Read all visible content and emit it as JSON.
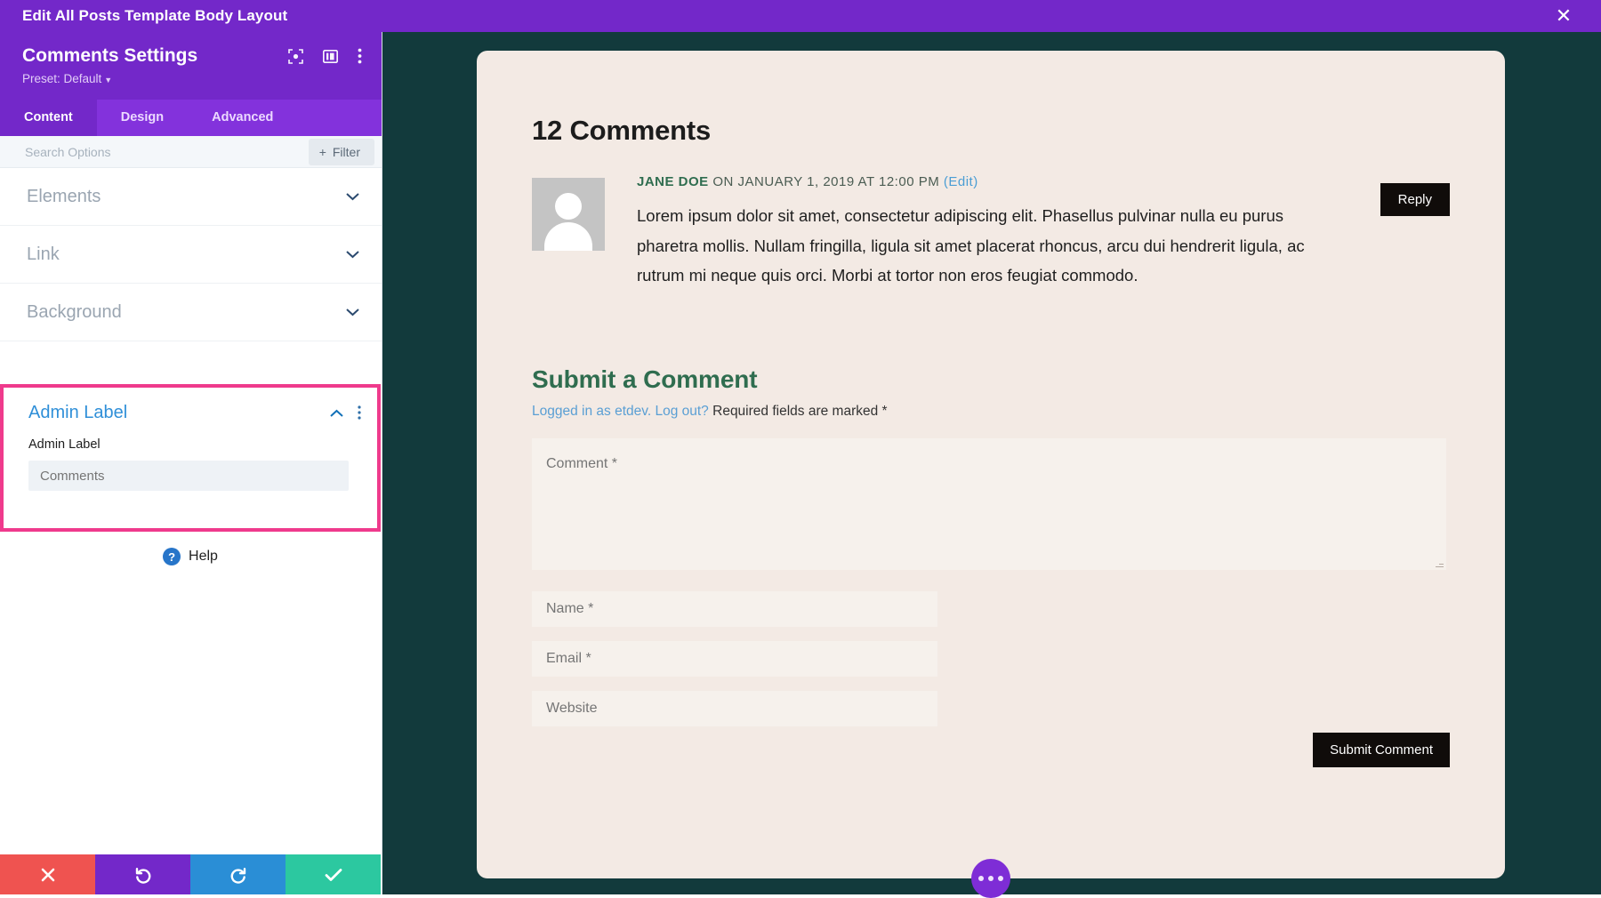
{
  "topbar": {
    "title": "Edit All Posts Template Body Layout",
    "close_icon": "close-icon"
  },
  "panel": {
    "title": "Comments Settings",
    "preset_label": "Preset: Default",
    "head_icons": [
      "fullscreen-icon",
      "layout-view-icon",
      "more-options-icon"
    ],
    "tabs": [
      {
        "label": "Content",
        "active": true
      },
      {
        "label": "Design",
        "active": false
      },
      {
        "label": "Advanced",
        "active": false
      }
    ],
    "search": {
      "placeholder": "Search Options"
    },
    "filter_button": {
      "label": "Filter",
      "plus": "+"
    },
    "sections": [
      {
        "label": "Elements",
        "state": "collapsed"
      },
      {
        "label": "Link",
        "state": "collapsed"
      },
      {
        "label": "Background",
        "state": "collapsed"
      }
    ],
    "admin_label_section": {
      "title": "Admin Label",
      "state": "expanded",
      "highlight_color": "#ef3a8c",
      "field_label": "Admin Label",
      "field_value": "",
      "field_placeholder": "Comments"
    },
    "help": {
      "label": "Help",
      "icon": "question-mark-icon"
    },
    "bottom_actions": [
      {
        "name": "cancel",
        "icon": "✕",
        "color": "#ef5350"
      },
      {
        "name": "undo",
        "icon": "↺",
        "color": "#7328c9"
      },
      {
        "name": "redo",
        "icon": "↻",
        "color": "#2a8ed6"
      },
      {
        "name": "save",
        "icon": "✔",
        "color": "#2cc8a0"
      }
    ]
  },
  "canvas": {
    "background_color": "#123a3c",
    "card_color": "#f3eae4",
    "comments_heading": "12 Comments",
    "comment": {
      "author": "JANE DOE",
      "meta_date": " ON JANUARY 1, 2019 AT 12:00 PM ",
      "edit_link": "(Edit)",
      "text": "Lorem ipsum dolor sit amet, consectetur adipiscing elit. Phasellus pulvinar nulla eu purus pharetra mollis. Nullam fringilla, ligula sit amet placerat rhoncus, arcu dui hendrerit ligula, ac rutrum mi neque quis orci. Morbi at tortor non eros feugiat commodo.",
      "reply_button": "Reply",
      "avatar": "default-avatar-icon"
    },
    "form": {
      "title": "Submit a Comment",
      "logged_in_text": "Logged in as etdev.",
      "logout_text": "Log out?",
      "required_text": "Required fields are marked *",
      "comment_placeholder": "Comment *",
      "name_placeholder": "Name *",
      "email_placeholder": "Email *",
      "website_placeholder": "Website",
      "submit_label": "Submit Comment"
    },
    "fab": {
      "icon": "ellipsis-icon",
      "color": "#7e2dd6"
    }
  }
}
